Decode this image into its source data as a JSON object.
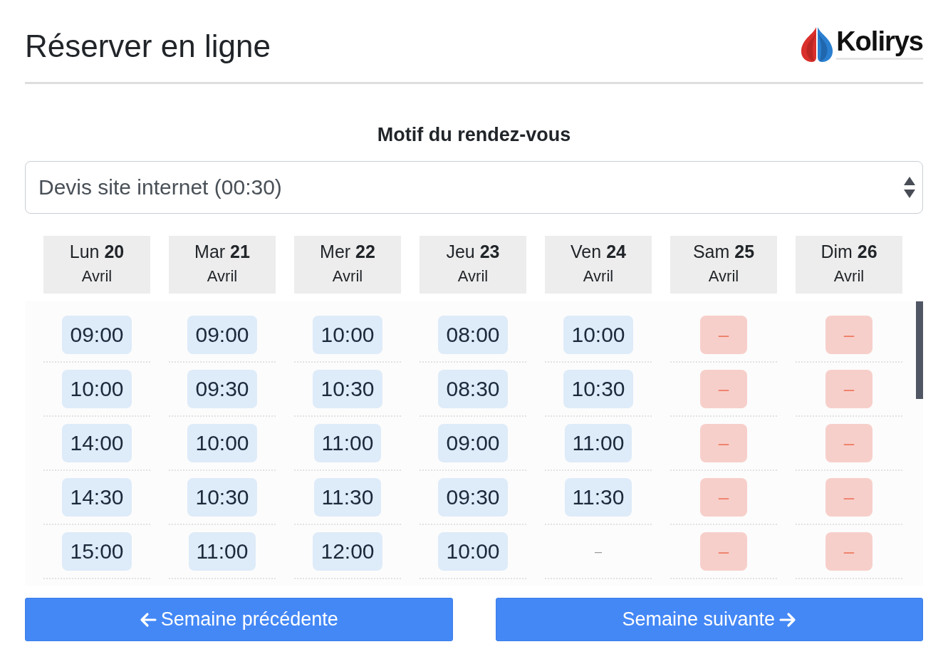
{
  "header": {
    "title": "Réserver en ligne",
    "logo_text": "Kolirys"
  },
  "reason": {
    "label": "Motif du rendez-vous",
    "value": "Devis site internet (00:30)"
  },
  "days": [
    {
      "label": "Lun **20**",
      "month": "Avril",
      "slots": [
        {
          "kind": "time",
          "label": "09:00"
        },
        {
          "kind": "time",
          "label": "10:00"
        },
        {
          "kind": "time",
          "label": "14:00"
        },
        {
          "kind": "time",
          "label": "14:30"
        },
        {
          "kind": "time",
          "label": "15:00"
        }
      ]
    },
    {
      "label": "Mar **21**",
      "month": "Avril",
      "slots": [
        {
          "kind": "time",
          "label": "09:00"
        },
        {
          "kind": "time",
          "label": "09:30"
        },
        {
          "kind": "time",
          "label": "10:00"
        },
        {
          "kind": "time",
          "label": "10:30"
        },
        {
          "kind": "time",
          "label": "11:00"
        }
      ]
    },
    {
      "label": "Mer **22**",
      "month": "Avril",
      "slots": [
        {
          "kind": "time",
          "label": "10:00"
        },
        {
          "kind": "time",
          "label": "10:30"
        },
        {
          "kind": "time",
          "label": "11:00"
        },
        {
          "kind": "time",
          "label": "11:30"
        },
        {
          "kind": "time",
          "label": "12:00"
        }
      ]
    },
    {
      "label": "Jeu **23**",
      "month": "Avril",
      "slots": [
        {
          "kind": "time",
          "label": "08:00"
        },
        {
          "kind": "time",
          "label": "08:30"
        },
        {
          "kind": "time",
          "label": "09:00"
        },
        {
          "kind": "time",
          "label": "09:30"
        },
        {
          "kind": "time",
          "label": "10:00"
        }
      ]
    },
    {
      "label": "Ven **24**",
      "month": "Avril",
      "slots": [
        {
          "kind": "time",
          "label": "10:00"
        },
        {
          "kind": "time",
          "label": "10:30"
        },
        {
          "kind": "time",
          "label": "11:00"
        },
        {
          "kind": "time",
          "label": "11:30"
        },
        {
          "kind": "empty",
          "label": "–"
        }
      ]
    },
    {
      "label": "Sam **25**",
      "month": "Avril",
      "slots": [
        {
          "kind": "closed",
          "label": "–"
        },
        {
          "kind": "closed",
          "label": "–"
        },
        {
          "kind": "closed",
          "label": "–"
        },
        {
          "kind": "closed",
          "label": "–"
        },
        {
          "kind": "closed",
          "label": "–"
        }
      ]
    },
    {
      "label": "Dim **26**",
      "month": "Avril",
      "slots": [
        {
          "kind": "closed",
          "label": "–"
        },
        {
          "kind": "closed",
          "label": "–"
        },
        {
          "kind": "closed",
          "label": "–"
        },
        {
          "kind": "closed",
          "label": "–"
        },
        {
          "kind": "closed",
          "label": "–"
        }
      ]
    }
  ],
  "buttons": [
    {
      "kind": "previous",
      "label": "Semaine précédente"
    },
    {
      "kind": "next",
      "label": "Semaine suivante"
    }
  ]
}
